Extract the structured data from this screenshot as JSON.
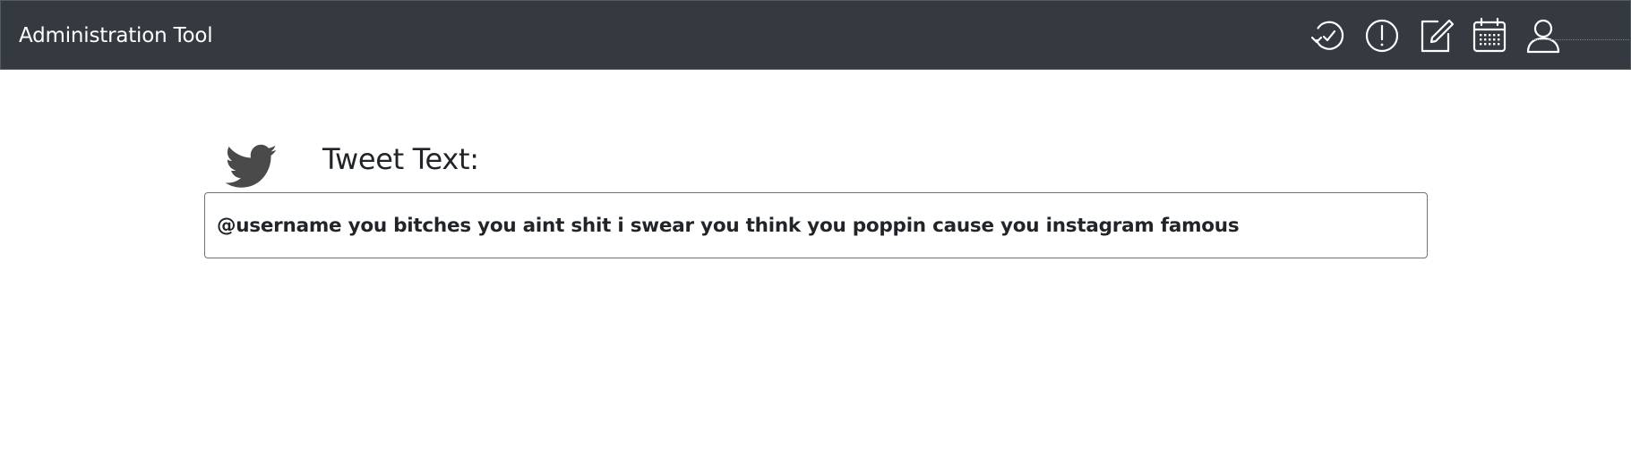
{
  "navbar": {
    "brand": "Administration Tool",
    "icons": [
      "history-icon",
      "alert-icon",
      "edit-icon",
      "calendar-icon",
      "user-icon"
    ],
    "background_color": "#353a40",
    "icon_color": "#ffffff"
  },
  "tweet": {
    "icon": "twitter-icon",
    "icon_color": "#4a4a4a",
    "label": "Tweet Text:",
    "text": "@username you bitches you aint shit i swear you think you poppin cause you instagram famous"
  }
}
